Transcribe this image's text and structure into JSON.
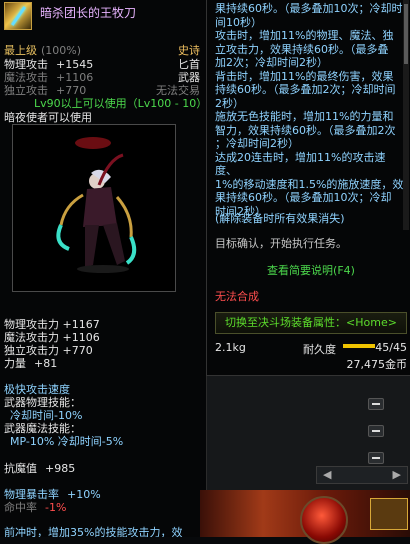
{
  "left": {
    "title": "暗杀团长的王牧刀",
    "level_label": "最上级",
    "level_pct": "(100%)",
    "rarity": "史诗",
    "phys_attack_label": "物理攻击",
    "phys_attack_value": "+1545",
    "weapon_type": "匕首",
    "mag_attack_label": "魔法攻击",
    "mag_attack_value": "+1106",
    "category": "武器",
    "indep_attack_label": "独立攻击",
    "indep_attack_value": "+770",
    "trade": "无法交易",
    "level_req": "Lv90以上可以使用（Lv100 - 10）",
    "class_req": "暗夜使者可以使用",
    "stats": [
      {
        "label": "物理攻击力",
        "value": "+1167"
      },
      {
        "label": "魔法攻击力",
        "value": "+1106"
      },
      {
        "label": "独立攻击力",
        "value": "+770"
      },
      {
        "label": "力量",
        "value": "+81"
      }
    ],
    "speed_title": "极快攻击速度",
    "weapon_phys_skill": "武器物理技能：",
    "phys_cd": "冷却时间-10%",
    "weapon_mag_skill": "武器魔法技能：",
    "mag_cd": "MP-10% 冷却时间-5%",
    "anti_magic_label": "抗魔值",
    "anti_magic_value": "+985",
    "crit_label": "物理暴击率",
    "crit_value": "+10%",
    "hit_label": "命中率",
    "hit_value": "-1%",
    "bottom_text": "前冲时，增加35%的技能攻击力，效"
  },
  "right": {
    "effect_lines": [
      "果持续60秒。（最多叠加10次；冷却时",
      "间10秒）",
      "攻击时，增加11%的物理、魔法、独",
      "立攻击力，效果持续60秒。（最多叠",
      "加2次；冷却时间2秒）",
      "背击时，增加11%的最终伤害，效果",
      "持续60秒。（最多叠加2次；冷却时间",
      "2秒）",
      "施放无色技能时，增加11%的力量和",
      "智力，效果持续60秒。（最多叠加2次",
      "；冷却时间2秒）",
      "达成20连击时，增加11%的攻击速度、",
      "1%的移动速度和1.5%的施放速度，效",
      "果持续60秒。（最多叠加10次；冷却",
      "时间2秒）"
    ],
    "unequip_note": "(解除装备时所有效果消失)",
    "target_confirm": "目标确认，开始执行任务。",
    "view_desc": "查看简要说明(F4)",
    "cannot_combine": "无法合成",
    "switch_attr": "切换至决斗场装备属性：<Home>",
    "weight": "2.1kg",
    "durability_label": "耐久度",
    "durability_value": "45/45",
    "durability_ratio": 1,
    "price": "27,475金币"
  },
  "colors": {
    "title": "#e8b4ff",
    "gold": "#e8c060",
    "green": "#4cd84c",
    "red": "#ff4e4e",
    "cyan": "#8fd3ff"
  }
}
